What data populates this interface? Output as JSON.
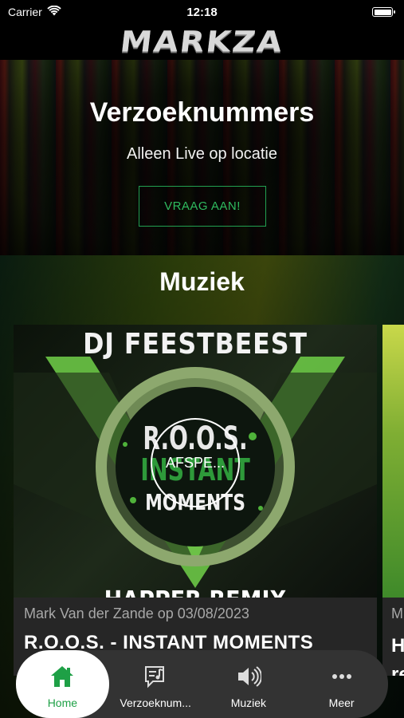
{
  "status_bar": {
    "carrier": "Carrier",
    "time": "12:18"
  },
  "header": {
    "logo": "MARKZA"
  },
  "hero": {
    "title": "Verzoeknummers",
    "subtitle": "Alleen Live op locatie",
    "button_label": "VRAAG AAN!"
  },
  "music": {
    "section_title": "Muziek",
    "cards": [
      {
        "cover_heading": "DJ FEESTBEEST",
        "cover_line1": "R.O.O.S.",
        "cover_line2": "INSTANT",
        "cover_line3": "MOMENTS",
        "cover_footer": "HAPPER REMIX",
        "play_label": "AFSPE...",
        "meta": "Mark Van der Zande op 03/08/2023",
        "title": "R.O.O.S. - INSTANT MOMENTS"
      },
      {
        "meta": "M",
        "title_line1": "H",
        "title_line2": "re"
      }
    ]
  },
  "tab_bar": {
    "tabs": [
      {
        "label": "Home",
        "icon": "home-icon",
        "active": true
      },
      {
        "label": "Verzoeknum...",
        "icon": "request-music-icon",
        "active": false
      },
      {
        "label": "Muziek",
        "icon": "speaker-icon",
        "active": false
      },
      {
        "label": "Meer",
        "icon": "more-icon",
        "active": false
      }
    ]
  },
  "colors": {
    "accent": "#1ea046",
    "tab_bar_bg": "#333333",
    "card_bg": "#262626"
  }
}
